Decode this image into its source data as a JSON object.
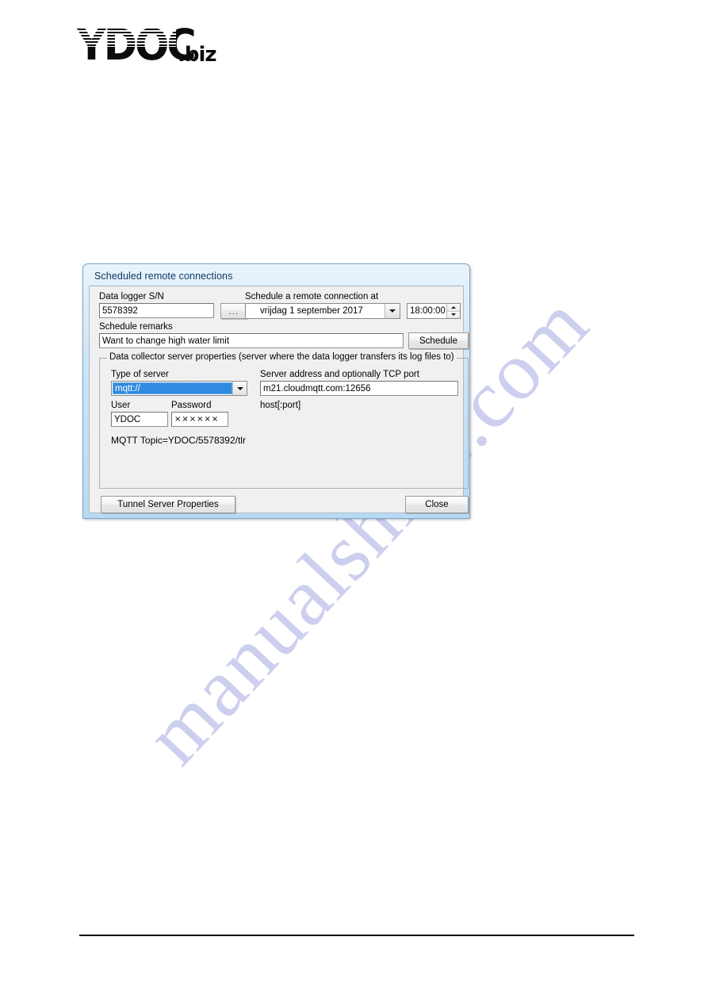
{
  "page": {
    "logo": {
      "main_text": "YDOC",
      "suffix_text": ".biz"
    }
  },
  "watermark": {
    "text": "manualshive.com",
    "color": "#b0b2e4"
  },
  "dialog": {
    "title": "Scheduled remote connections",
    "colors": {
      "titlebar_top": "#e9f3fb",
      "titlebar_bottom": "#b9d9f2",
      "client_bg": "#f0f0f0",
      "selection_blue": "#2f8ae0",
      "title_text": "#0d3a64"
    },
    "serial": {
      "label": "Data logger S/N",
      "value": "5578392",
      "browse_button_label": "..."
    },
    "schedule_at": {
      "label": "Schedule a remote connection at",
      "date_value": "vrijdag      1 september 2017",
      "time_value": "18:00:00"
    },
    "remarks": {
      "label": "Schedule remarks",
      "value": "Want to change high water limit",
      "schedule_button_label": "Schedule"
    },
    "group": {
      "legend": "Data collector server properties (server where the data logger transfers its log files to)",
      "server_type": {
        "label": "Type of server",
        "selected": "mqtt://"
      },
      "server_address": {
        "label": "Server address and optionally TCP port",
        "value": "m21.cloudmqtt.com:12656",
        "hint": "host[:port]"
      },
      "user": {
        "label": "User",
        "value": "YDOC"
      },
      "password": {
        "label": "Password",
        "masked_value": "××××××"
      },
      "mqtt_topic": "MQTT Topic=YDOC/5578392/tlr"
    },
    "footer": {
      "tunnel_button_label": "Tunnel Server Properties",
      "close_button_label": "Close"
    }
  }
}
